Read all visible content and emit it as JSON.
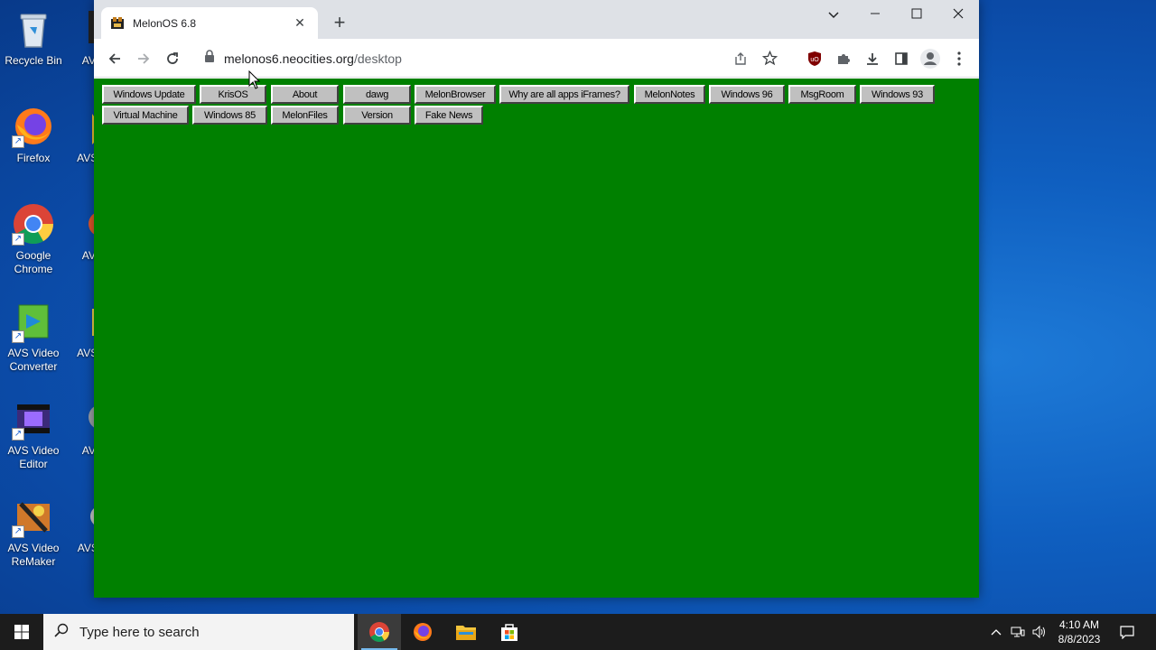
{
  "desktop": {
    "icons_col1": [
      {
        "label": "Recycle Bin",
        "icon": "recycle-bin-icon"
      },
      {
        "label": "Firefox",
        "icon": "firefox-icon"
      },
      {
        "label": "Google Chrome",
        "icon": "chrome-icon"
      },
      {
        "label": "AVS Video Converter",
        "icon": "avs-video-converter-icon"
      },
      {
        "label": "AVS Video Editor",
        "icon": "avs-video-editor-icon"
      },
      {
        "label": "AVS Video ReMaker",
        "icon": "avs-video-remaker-icon"
      }
    ],
    "icons_col2_partial": [
      "AVS P",
      "AVS Cor",
      "AVS E",
      "AVS Cor",
      "AVS E",
      "AVS I Cl"
    ]
  },
  "browser": {
    "tab_title": "MelonOS 6.8",
    "url_host": "melonos6.neocities.org",
    "url_path": "/desktop"
  },
  "page": {
    "background": "#008000",
    "row1": [
      "Windows Update",
      "KrisOS",
      "About",
      "dawg",
      "MelonBrowser",
      "Why are all apps iFrames?",
      "MelonNotes",
      "Windows 96",
      "MsgRoom",
      "Windows 93"
    ],
    "row2": [
      "Virtual Machine",
      "Windows 85",
      "MelonFiles",
      "Version",
      "Fake News"
    ]
  },
  "taskbar": {
    "search_placeholder": "Type here to search",
    "time": "4:10 AM",
    "date": "8/8/2023"
  }
}
